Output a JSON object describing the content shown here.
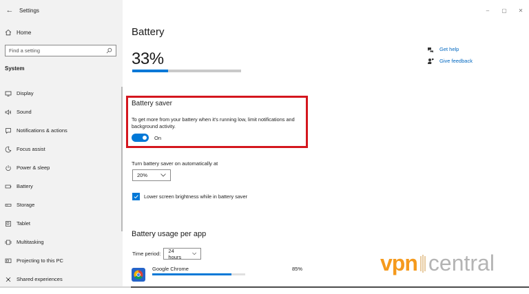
{
  "window": {
    "app_title": "Settings",
    "back_glyph": "←",
    "minimize_glyph": "–",
    "maximize_glyph": "▢",
    "close_glyph": "✕"
  },
  "sidebar": {
    "home_label": "Home",
    "search_placeholder": "Find a setting",
    "section_label": "System",
    "items": [
      {
        "label": "Display",
        "icon": "monitor-icon"
      },
      {
        "label": "Sound",
        "icon": "speaker-icon"
      },
      {
        "label": "Notifications & actions",
        "icon": "notification-icon"
      },
      {
        "label": "Focus assist",
        "icon": "moon-icon"
      },
      {
        "label": "Power & sleep",
        "icon": "power-icon"
      },
      {
        "label": "Battery",
        "icon": "battery-icon"
      },
      {
        "label": "Storage",
        "icon": "storage-icon"
      },
      {
        "label": "Tablet",
        "icon": "tablet-icon"
      },
      {
        "label": "Multitasking",
        "icon": "multitasking-icon"
      },
      {
        "label": "Projecting to this PC",
        "icon": "projecting-icon"
      },
      {
        "label": "Shared experiences",
        "icon": "shared-experiences-icon"
      }
    ]
  },
  "main": {
    "title": "Battery",
    "battery_percent_text": "33%",
    "battery_level": 0.33,
    "help_links": [
      {
        "label": "Get help",
        "icon": "help-icon"
      },
      {
        "label": "Give feedback",
        "icon": "feedback-icon"
      }
    ],
    "battery_saver": {
      "title": "Battery saver",
      "description": "To get more from your battery when it's running low, limit notifications and background activity.",
      "toggle_state_label": "On",
      "enabled": true
    },
    "auto_on": {
      "label": "Turn battery saver on automatically at",
      "selected_value": "20%"
    },
    "lower_brightness": {
      "label": "Lower screen brightness while in battery saver",
      "checked": true
    },
    "usage": {
      "title": "Battery usage per app",
      "time_period_label": "Time period:",
      "time_period_value": "24 hours",
      "apps": [
        {
          "name": "Google Chrome",
          "percent_text": "85%",
          "percent": 0.85,
          "icon": "chrome-icon"
        }
      ]
    }
  },
  "watermark": {
    "brand_part1": "vpn",
    "brand_part2": "central",
    "colors": {
      "primary": "#f59a1d",
      "secondary": "#b4b4b4"
    }
  },
  "colors": {
    "accent": "#0078d7",
    "highlight_border": "#d4161e",
    "link": "#0067c0",
    "sidebar_bg": "#f2f2f2"
  }
}
